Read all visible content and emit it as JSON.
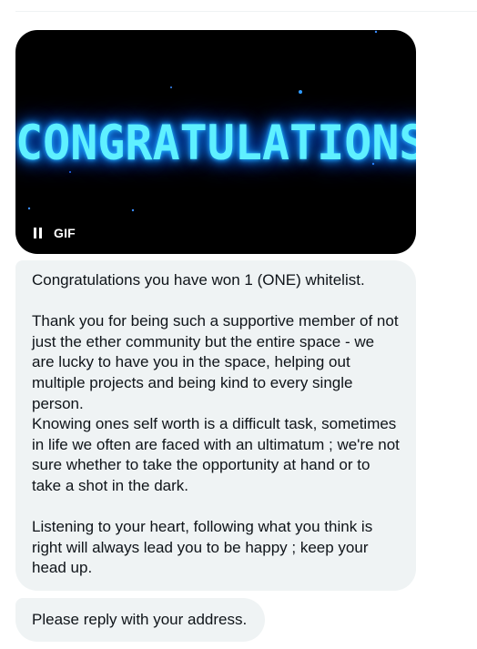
{
  "gif": {
    "banner_text": "CONGRATULATIONS",
    "label": "GIF",
    "pause_icon": "pause-icon",
    "colors": {
      "background": "#000000",
      "glow": "#1fa8ff",
      "text": "#5ff0ff"
    }
  },
  "messages": [
    {
      "text": "Congratulations you have won 1 (ONE) whitelist.\n\nThank you for being such a supportive member of not just the ether community but the entire space - we are lucky to have you in the space, helping out multiple projects and being kind to every single person.\nKnowing ones self worth is a difficult task, sometimes in life we often are faced with an ultimatum ; we're not sure whether to take the opportunity at hand or to take a shot in the dark.\n\nListening to your heart, following what you think is right will always lead you to be happy ; keep your head up."
    },
    {
      "text": "Please reply with your address."
    }
  ],
  "colors": {
    "bubble_bg": "#eff3f4",
    "text": "#0f1419"
  }
}
